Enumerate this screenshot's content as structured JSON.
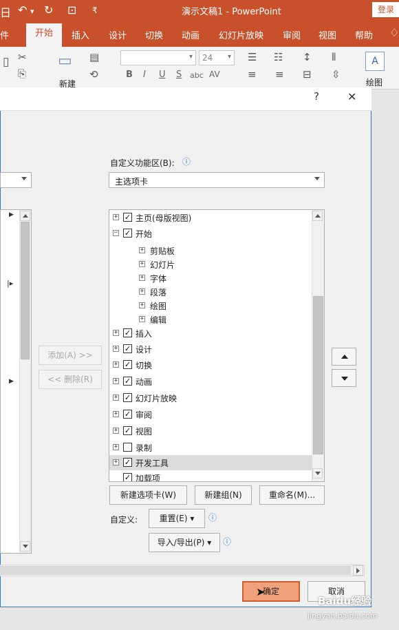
{
  "titlebar": {
    "left_glyph": "日",
    "undo_icon": "↶",
    "redo_icon": "↻",
    "present_icon": "⊡",
    "customize_icon": "₹",
    "doc_title": "演示文稿1 - PowerPoint",
    "login": "登录"
  },
  "tabs": [
    {
      "label": "件"
    },
    {
      "label": "开始"
    },
    {
      "label": "插入"
    },
    {
      "label": "设计"
    },
    {
      "label": "切换"
    },
    {
      "label": "动画"
    },
    {
      "label": "幻灯片放映"
    },
    {
      "label": "审阅"
    },
    {
      "label": "视图"
    },
    {
      "label": "帮助"
    }
  ],
  "ribbon": {
    "new_slide_label": "新建",
    "font_size": "24",
    "bold": "B",
    "italic": "I",
    "underline": "U",
    "strike": "S",
    "abc": "abc",
    "av": "AV",
    "draw_label": "绘图"
  },
  "dialog": {
    "help_icon": "?",
    "close_icon": "✕",
    "right_header_label": "自定义功能区(B):",
    "right_dropdown_value": "主选项卡",
    "info_icon": "ⓘ",
    "add_button": "添加(A) >>",
    "remove_button": "<< 删除(R)",
    "tree": [
      {
        "label": "主页(母版视图)",
        "expander": "+",
        "checked": true,
        "indent": 0
      },
      {
        "label": "开始",
        "expander": "−",
        "checked": true,
        "indent": 0
      },
      {
        "label": "剪贴板",
        "expander": "+",
        "checked": null,
        "indent": 1
      },
      {
        "label": "幻灯片",
        "expander": "+",
        "checked": null,
        "indent": 1
      },
      {
        "label": "字体",
        "expander": "+",
        "checked": null,
        "indent": 1
      },
      {
        "label": "段落",
        "expander": "+",
        "checked": null,
        "indent": 1
      },
      {
        "label": "绘图",
        "expander": "+",
        "checked": null,
        "indent": 1
      },
      {
        "label": "编辑",
        "expander": "+",
        "checked": null,
        "indent": 1
      },
      {
        "label": "插入",
        "expander": "+",
        "checked": true,
        "indent": 0
      },
      {
        "label": "设计",
        "expander": "+",
        "checked": true,
        "indent": 0
      },
      {
        "label": "切换",
        "expander": "+",
        "checked": true,
        "indent": 0
      },
      {
        "label": "动画",
        "expander": "+",
        "checked": true,
        "indent": 0
      },
      {
        "label": "幻灯片放映",
        "expander": "+",
        "checked": true,
        "indent": 0
      },
      {
        "label": "审阅",
        "expander": "+",
        "checked": true,
        "indent": 0
      },
      {
        "label": "视图",
        "expander": "+",
        "checked": true,
        "indent": 0
      },
      {
        "label": "录制",
        "expander": "+",
        "checked": false,
        "indent": 0
      },
      {
        "label": "开发工具",
        "expander": "+",
        "checked": true,
        "indent": 0,
        "selected": true
      },
      {
        "label": "加载项",
        "expander": "",
        "checked": true,
        "indent": 0
      }
    ],
    "new_tab_button": "新建选项卡(W)",
    "new_group_button": "新建组(N)",
    "rename_button": "重命名(M)...",
    "customize_label": "自定义:",
    "reset_button": "重置(E) ▾",
    "import_export_button": "导入/导出(P) ▾",
    "ok_button": "确定",
    "cancel_button": "取消"
  },
  "watermark": {
    "line1": "Baidu经验",
    "line2": "jingyan.baidu.com"
  }
}
